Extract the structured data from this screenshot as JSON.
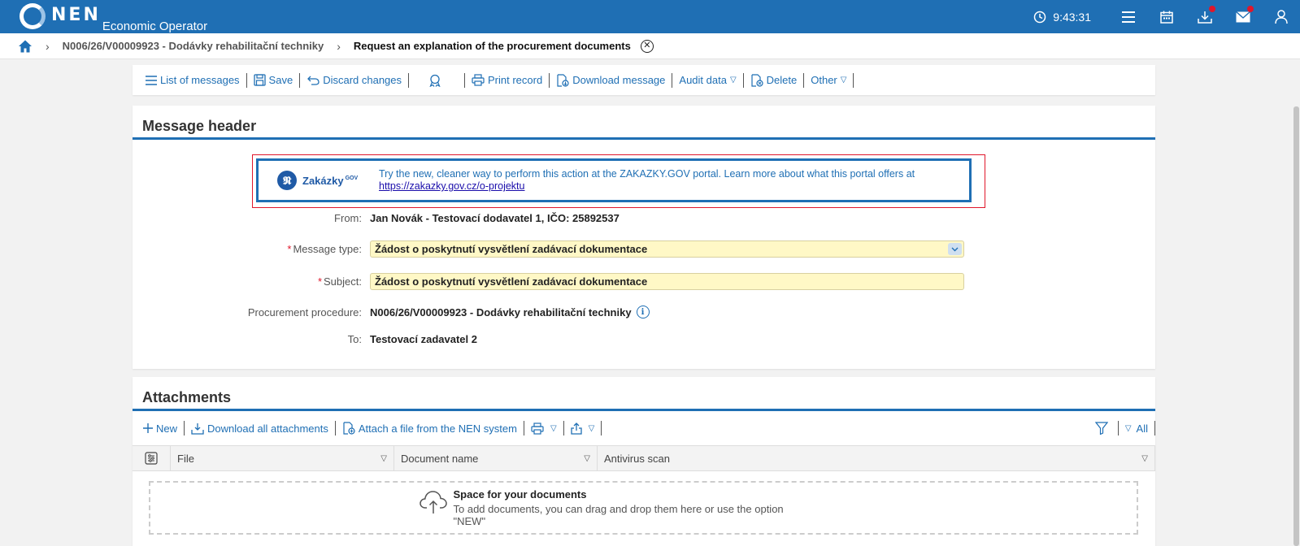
{
  "app": {
    "logo_text": "NEN",
    "subtitle": "Economic Operator",
    "time": "9:43:31"
  },
  "breadcrumb": {
    "procedure": "N006/26/V00009923 - Dodávky rehabilitační techniky",
    "current": "Request an explanation of the procurement documents"
  },
  "toolbar": {
    "list_of_messages": "List of messages",
    "save": "Save",
    "discard_changes": "Discard changes",
    "print_record": "Print record",
    "download_message": "Download message",
    "audit_data": "Audit data",
    "delete": "Delete",
    "other": "Other"
  },
  "message_header": {
    "title": "Message header",
    "banner": {
      "logo_name": "Zakázky",
      "logo_sup": "GOV",
      "text": "Try the new, cleaner way to perform this action at the ZAKAZKY.GOV portal. Learn more about what this portal offers at",
      "link": "https://zakazky.gov.cz/o-projektu"
    },
    "from_label": "From:",
    "from_value": "Jan Novák - Testovací dodavatel 1, IČO: 25892537",
    "message_type_label": "Message type:",
    "message_type_value": "Žádost o poskytnutí vysvětlení zadávací dokumentace",
    "subject_label": "Subject:",
    "subject_value": "Žádost o poskytnutí vysvětlení zadávací dokumentace",
    "procedure_label": "Procurement procedure:",
    "procedure_value": "N006/26/V00009923 - Dodávky rehabilitační techniky",
    "to_label": "To:",
    "to_value": "Testovací zadavatel 2",
    "required_mark": "*"
  },
  "attachments": {
    "title": "Attachments",
    "new": "New",
    "download_all": "Download all attachments",
    "attach_nen": "Attach a file from the NEN system",
    "filter_all": "All",
    "columns": [
      "File",
      "Document name",
      "Antivirus scan"
    ],
    "dropzone_title": "Space for your documents",
    "dropzone_text": "To add documents, you can drag and drop them here or use the option \"NEW\""
  },
  "colors": {
    "brand": "#1f6fb4",
    "required": "#e0162b",
    "field_bg": "#fff8c6"
  }
}
